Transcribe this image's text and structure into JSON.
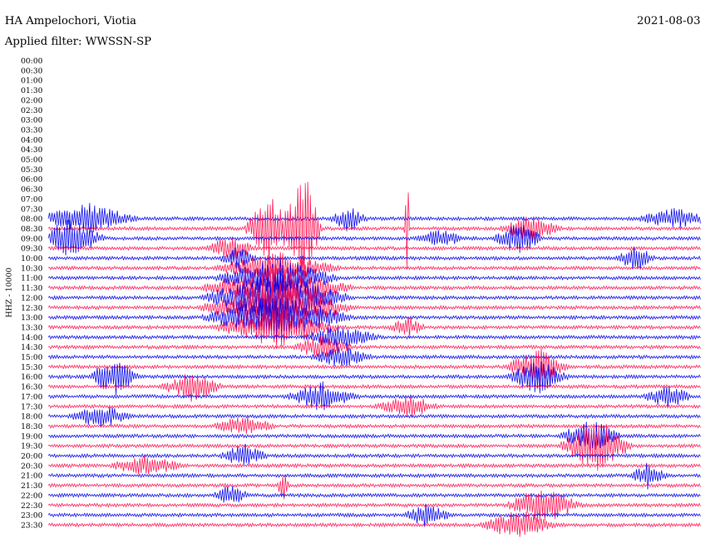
{
  "header": {
    "station": "HA Ampelochori, Viotia",
    "date": "2021-08-03",
    "filter": "Applied filter: WWSSN-SP"
  },
  "chart_data": {
    "type": "helicorder",
    "ylabel": "HHZ - 10000",
    "y_tick_labels": [
      "00:00",
      "00:30",
      "01:00",
      "01:30",
      "02:00",
      "02:30",
      "03:00",
      "03:30",
      "04:00",
      "04:30",
      "05:00",
      "05:30",
      "06:00",
      "06:30",
      "07:00",
      "07:30",
      "08:00",
      "08:30",
      "09:00",
      "09:30",
      "10:00",
      "10:30",
      "11:00",
      "11:30",
      "12:00",
      "12:30",
      "13:00",
      "13:30",
      "14:00",
      "14:30",
      "15:00",
      "15:30",
      "16:00",
      "16:30",
      "17:00",
      "17:30",
      "18:00",
      "18:30",
      "19:00",
      "19:30",
      "20:00",
      "20:30",
      "21:00",
      "21:30",
      "22:00",
      "22:30",
      "23:00",
      "23:30"
    ],
    "first_trace_time": "08:00",
    "trace_colors": [
      "#0000ee",
      "#ff1150"
    ],
    "events": [
      {
        "time": "08:00",
        "position": 0.06,
        "amplitude": 2.4,
        "duration": 0.08
      },
      {
        "time": "08:00",
        "position": 0.46,
        "amplitude": 1.9,
        "duration": 0.03
      },
      {
        "time": "08:00",
        "position": 0.96,
        "amplitude": 1.6,
        "duration": 0.06
      },
      {
        "time": "08:30",
        "position": 0.34,
        "amplitude": 6.0,
        "duration": 0.04
      },
      {
        "time": "08:30",
        "position": 0.39,
        "amplitude": 9.5,
        "duration": 0.03
      },
      {
        "time": "08:30",
        "position": 0.55,
        "amplitude": 10.0,
        "duration": 0.004
      },
      {
        "time": "08:30",
        "position": 0.74,
        "amplitude": 2.0,
        "duration": 0.05
      },
      {
        "time": "09:00",
        "position": 0.03,
        "amplitude": 3.0,
        "duration": 0.06
      },
      {
        "time": "09:00",
        "position": 0.6,
        "amplitude": 1.5,
        "duration": 0.04
      },
      {
        "time": "09:00",
        "position": 0.72,
        "amplitude": 2.5,
        "duration": 0.04
      },
      {
        "time": "09:30",
        "position": 0.28,
        "amplitude": 2.0,
        "duration": 0.04
      },
      {
        "time": "10:00",
        "position": 0.29,
        "amplitude": 1.8,
        "duration": 0.03
      },
      {
        "time": "10:00",
        "position": 0.9,
        "amplitude": 2.2,
        "duration": 0.03
      },
      {
        "time": "10:30",
        "position": 0.35,
        "amplitude": 2.4,
        "duration": 0.1
      },
      {
        "time": "11:00",
        "position": 0.35,
        "amplitude": 3.0,
        "duration": 0.1
      },
      {
        "time": "11:30",
        "position": 0.35,
        "amplitude": 3.5,
        "duration": 0.12
      },
      {
        "time": "12:00",
        "position": 0.35,
        "amplitude": 4.0,
        "duration": 0.12
      },
      {
        "time": "12:30",
        "position": 0.35,
        "amplitude": 4.2,
        "duration": 0.12
      },
      {
        "time": "13:00",
        "position": 0.35,
        "amplitude": 3.5,
        "duration": 0.12
      },
      {
        "time": "13:30",
        "position": 0.35,
        "amplitude": 3.0,
        "duration": 0.1
      },
      {
        "time": "13:30",
        "position": 0.55,
        "amplitude": 1.6,
        "duration": 0.03
      },
      {
        "time": "14:00",
        "position": 0.45,
        "amplitude": 2.0,
        "duration": 0.06
      },
      {
        "time": "14:30",
        "position": 0.42,
        "amplitude": 1.8,
        "duration": 0.05
      },
      {
        "time": "15:00",
        "position": 0.45,
        "amplitude": 1.6,
        "duration": 0.05
      },
      {
        "time": "15:30",
        "position": 0.75,
        "amplitude": 3.0,
        "duration": 0.05
      },
      {
        "time": "16:00",
        "position": 0.1,
        "amplitude": 3.0,
        "duration": 0.04
      },
      {
        "time": "16:00",
        "position": 0.75,
        "amplitude": 2.5,
        "duration": 0.05
      },
      {
        "time": "16:30",
        "position": 0.22,
        "amplitude": 2.2,
        "duration": 0.05
      },
      {
        "time": "17:00",
        "position": 0.42,
        "amplitude": 2.2,
        "duration": 0.06
      },
      {
        "time": "17:00",
        "position": 0.95,
        "amplitude": 1.8,
        "duration": 0.04
      },
      {
        "time": "17:30",
        "position": 0.55,
        "amplitude": 1.8,
        "duration": 0.05
      },
      {
        "time": "18:00",
        "position": 0.08,
        "amplitude": 1.8,
        "duration": 0.05
      },
      {
        "time": "18:30",
        "position": 0.3,
        "amplitude": 1.6,
        "duration": 0.05
      },
      {
        "time": "19:00",
        "position": 0.83,
        "amplitude": 2.5,
        "duration": 0.05
      },
      {
        "time": "19:30",
        "position": 0.84,
        "amplitude": 3.8,
        "duration": 0.06
      },
      {
        "time": "20:00",
        "position": 0.3,
        "amplitude": 1.8,
        "duration": 0.04
      },
      {
        "time": "20:30",
        "position": 0.15,
        "amplitude": 1.6,
        "duration": 0.06
      },
      {
        "time": "21:00",
        "position": 0.92,
        "amplitude": 2.0,
        "duration": 0.03
      },
      {
        "time": "21:30",
        "position": 0.36,
        "amplitude": 2.4,
        "duration": 0.01
      },
      {
        "time": "22:00",
        "position": 0.28,
        "amplitude": 1.8,
        "duration": 0.03
      },
      {
        "time": "22:30",
        "position": 0.76,
        "amplitude": 3.0,
        "duration": 0.06
      },
      {
        "time": "23:00",
        "position": 0.58,
        "amplitude": 1.8,
        "duration": 0.04
      },
      {
        "time": "23:30",
        "position": 0.72,
        "amplitude": 2.4,
        "duration": 0.06
      }
    ]
  }
}
